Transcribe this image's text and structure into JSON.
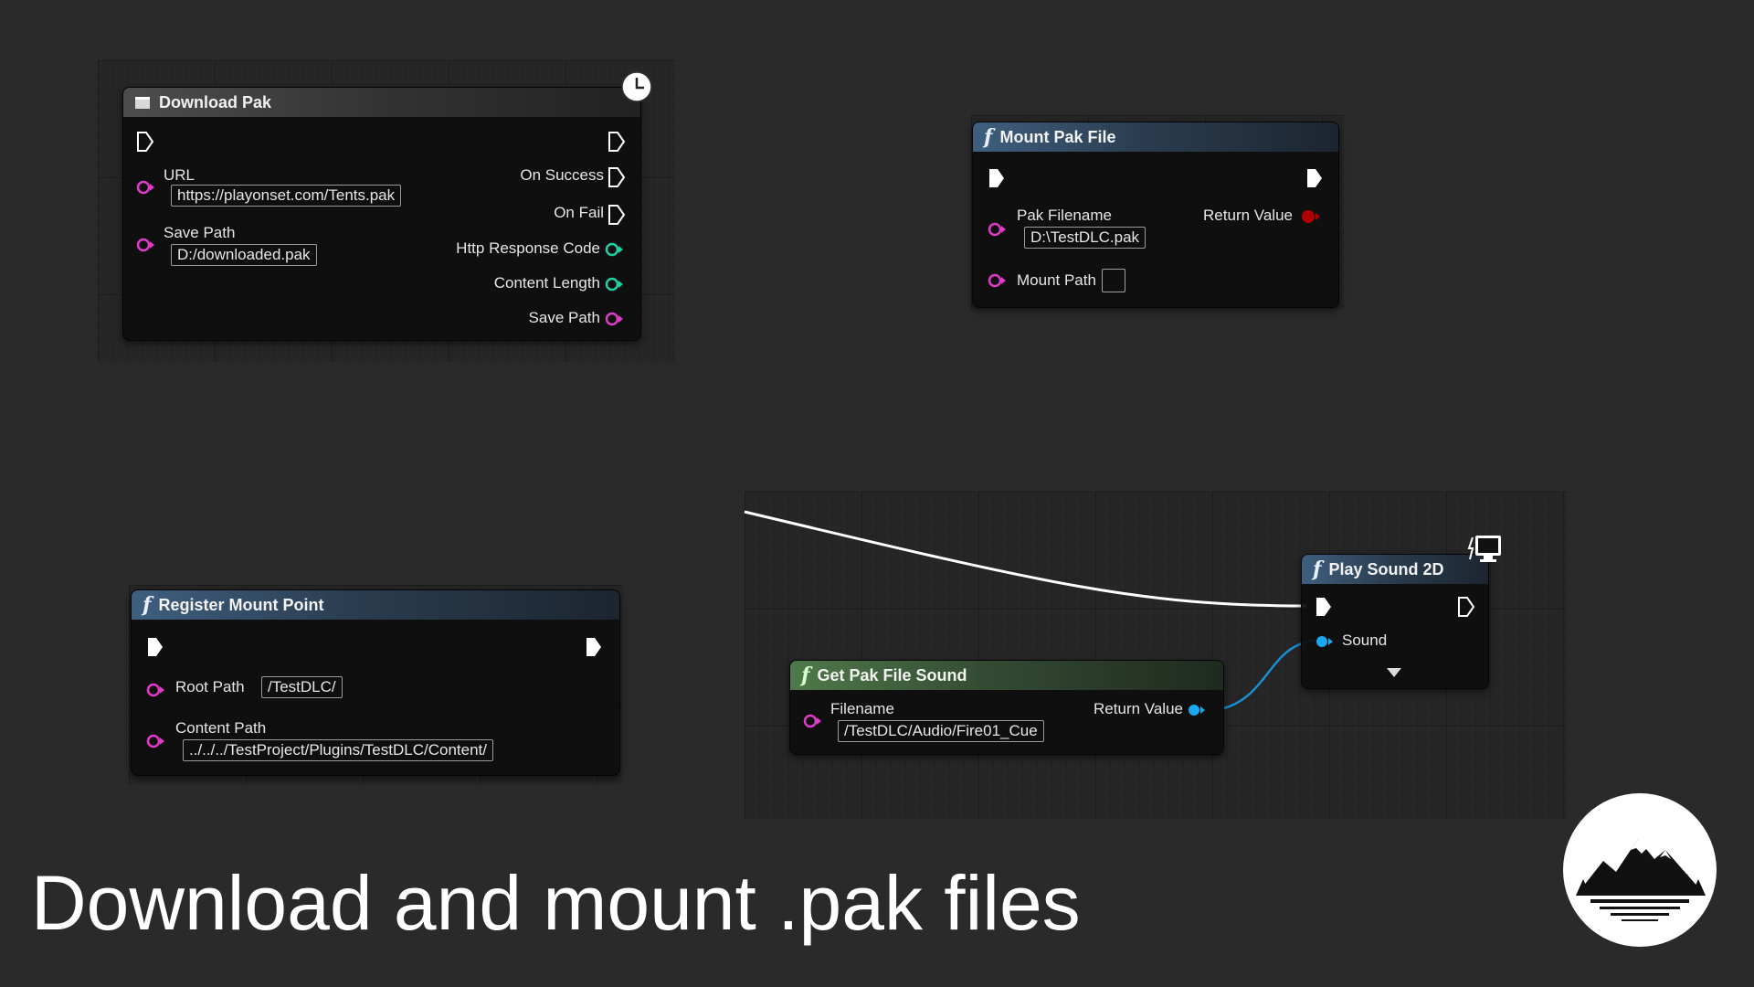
{
  "page": {
    "title": "Download and mount .pak files"
  },
  "colors": {
    "background": "#2a2a2a",
    "function_header": "#3f5f7f",
    "pure_header": "#4f7a4a",
    "exec_pin": "#ffffff",
    "string_pin": "#e03cc8",
    "int_pin": "#1fd0a0",
    "bool_pin": "#b00000",
    "object_pin": "#1aa8f0",
    "wire": "#ffffff"
  },
  "nodes": {
    "download_pak": {
      "title": "Download Pak",
      "icon": "latent-clock-icon",
      "inputs": {
        "url_label": "URL",
        "url_value": "https://playonset.com/Tents.pak",
        "save_path_label": "Save Path",
        "save_path_value": "D:/downloaded.pak"
      },
      "outputs": {
        "on_success": "On Success",
        "on_fail": "On Fail",
        "http_response_code": "Http Response Code",
        "content_length": "Content Length",
        "save_path": "Save Path"
      }
    },
    "mount_pak_file": {
      "title": "Mount Pak File",
      "inputs": {
        "pak_filename_label": "Pak Filename",
        "pak_filename_value": "D:\\TestDLC.pak",
        "mount_path_label": "Mount Path"
      },
      "outputs": {
        "return_value": "Return Value"
      }
    },
    "register_mount_point": {
      "title": "Register Mount Point",
      "inputs": {
        "root_path_label": "Root Path",
        "root_path_value": "/TestDLC/",
        "content_path_label": "Content Path",
        "content_path_value": "../../../TestProject/Plugins/TestDLC/Content/"
      }
    },
    "get_pak_file_sound": {
      "title": "Get Pak File Sound",
      "inputs": {
        "filename_label": "Filename",
        "filename_value": "/TestDLC/Audio/Fire01_Cue"
      },
      "outputs": {
        "return_value": "Return Value"
      }
    },
    "play_sound_2d": {
      "title": "Play Sound 2D",
      "icon": "client-only-monitor-icon",
      "inputs": {
        "sound_label": "Sound"
      }
    }
  }
}
